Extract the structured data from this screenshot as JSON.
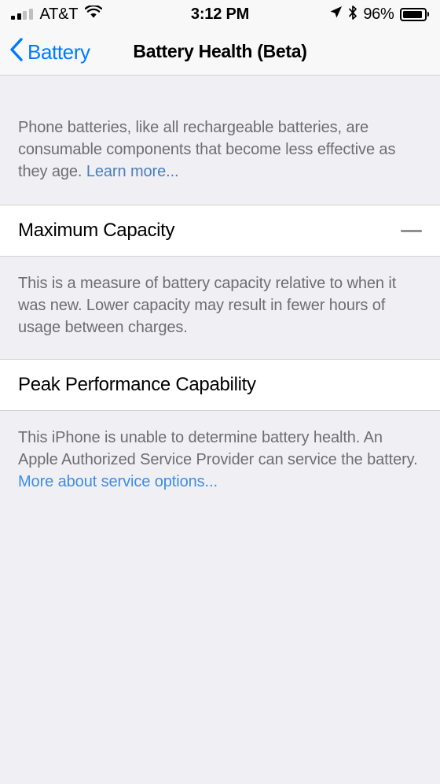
{
  "status_bar": {
    "carrier": "AT&T",
    "signal_icon": "signal-bars-icon",
    "signal_bars_filled": 2,
    "signal_bars_total": 4,
    "wifi_icon": "wifi-icon",
    "time": "3:12 PM",
    "location_icon": "location-arrow-icon",
    "bluetooth_icon": "bluetooth-icon",
    "battery_percent": "96%",
    "battery_icon": "battery-icon"
  },
  "nav": {
    "back_icon": "chevron-left-icon",
    "back_label": "Battery",
    "title": "Battery Health (Beta)"
  },
  "intro": {
    "text": "Phone batteries, like all rechargeable batteries, are consumable components that become less effective as they age. ",
    "link": "Learn more..."
  },
  "maximum_capacity": {
    "title": "Maximum Capacity",
    "value": "—",
    "value_icon": "dash-icon",
    "description": "This is a measure of battery capacity relative to when it was new. Lower capacity may result in fewer hours of usage between charges."
  },
  "peak_performance": {
    "title": "Peak Performance Capability",
    "description": "This iPhone is unable to determine battery health. An Apple Authorized Service Provider can service the battery. ",
    "link": "More about service options..."
  },
  "colors": {
    "accent_blue": "#007AFF",
    "link_blue": "#3E8EDE",
    "secondary_text": "#6D6D72",
    "group_background": "#EFEFF4",
    "cell_background": "#FFFFFF"
  }
}
